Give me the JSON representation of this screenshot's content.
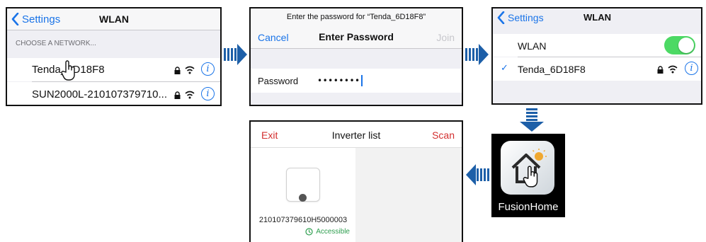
{
  "step1": {
    "back_label": "Settings",
    "title": "WLAN",
    "section_header": "CHOOSE A NETWORK...",
    "networks": [
      {
        "name": "Tenda_6D18F8"
      },
      {
        "name": "SUN2000L-210107379710..."
      }
    ]
  },
  "step2": {
    "prompt": "Enter the password for “Tenda_6D18F8”",
    "cancel_label": "Cancel",
    "title": "Enter Password",
    "join_label": "Join",
    "password_label": "Password",
    "password_value": "••••••••"
  },
  "step3": {
    "back_label": "Settings",
    "title": "WLAN",
    "wlan_label": "WLAN",
    "wlan_on": true,
    "connected_network": "Tenda_6D18F8",
    "check_mark": "✓"
  },
  "step4": {
    "app_name": "FusionHome"
  },
  "step5": {
    "exit_label": "Exit",
    "title": "Inverter list",
    "scan_label": "Scan",
    "device_sn": "210107379610H5000003",
    "device_status": "Accessible"
  },
  "colors": {
    "ios_blue": "#1a74e8",
    "toggle_green": "#4cd964",
    "red": "#d32f2f",
    "arrow_blue": "#1d5fa8",
    "status_green": "#2e9e4f"
  },
  "icons": [
    "chevron-left-icon",
    "lock-icon",
    "wifi-icon",
    "info-icon",
    "hand-pointer-icon",
    "checkmark-icon",
    "house-sun-icon",
    "inverter-device-icon",
    "status-circle-icon",
    "flow-arrow-icon"
  ]
}
